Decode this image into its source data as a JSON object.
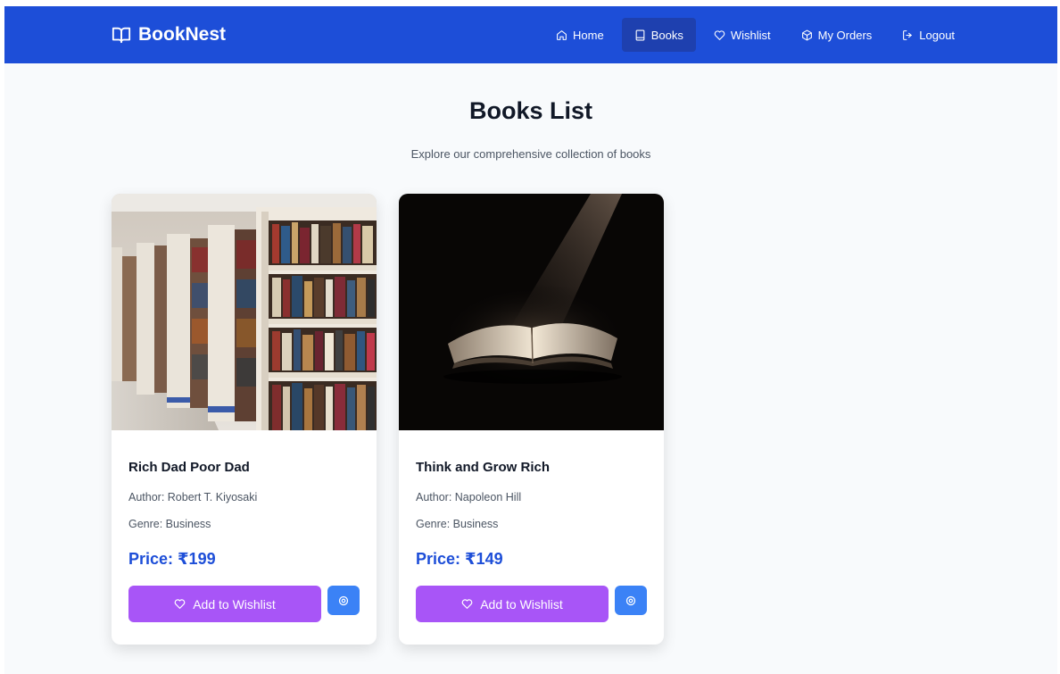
{
  "brand": {
    "name": "BookNest",
    "icon": "open-book-icon"
  },
  "nav": [
    {
      "label": "Home",
      "icon": "home-icon",
      "active": false
    },
    {
      "label": "Books",
      "icon": "book-icon",
      "active": true
    },
    {
      "label": "Wishlist",
      "icon": "heart-icon",
      "active": false
    },
    {
      "label": "My Orders",
      "icon": "package-icon",
      "active": false
    },
    {
      "label": "Logout",
      "icon": "logout-icon",
      "active": false
    }
  ],
  "page": {
    "title": "Books List",
    "subtitle": "Explore our comprehensive collection of books"
  },
  "books": [
    {
      "title": "Rich Dad Poor Dad",
      "author": "Author: Robert T. Kiyosaki",
      "genre": "Genre: Business",
      "price": "Price: ₹199",
      "wishlist_label": "Add to Wishlist",
      "cover": "library-shelves-photo"
    },
    {
      "title": "Think and Grow Rich",
      "author": "Author: Napoleon Hill",
      "genre": "Genre: Business",
      "price": "Price: ₹149",
      "wishlist_label": "Add to Wishlist",
      "cover": "open-book-spotlight-photo"
    }
  ],
  "colors": {
    "navbar": "#1d4ed8",
    "nav_active": "#1e40af",
    "price": "#1d4ed8",
    "wishlist_button": "#a855f7",
    "view_button": "#3b82f6",
    "background": "#f8fafc"
  }
}
